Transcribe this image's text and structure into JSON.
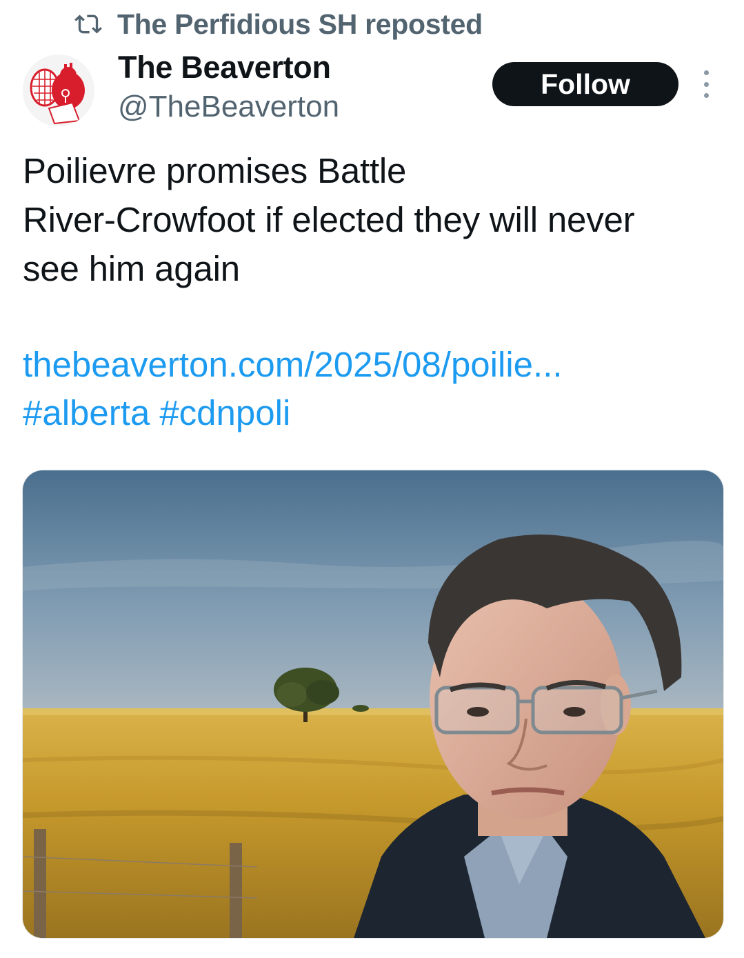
{
  "repost": {
    "label": "The Perfidious SH reposted",
    "icon": "repost-icon"
  },
  "author": {
    "name": "The Beaverton",
    "handle": "@TheBeaverton",
    "avatar_icon": "beaver-logo-icon"
  },
  "follow_label": "Follow",
  "more_icon": "more-options-icon",
  "tweet": {
    "lines": [
      "Poilievre promises Battle",
      "River-Crowfoot if elected they will never",
      "see him again"
    ],
    "link": "thebeaverton.com/2025/08/poilie...",
    "hashtags": [
      "#alberta",
      "#cdnpoli"
    ]
  },
  "colors": {
    "text": "#0f1419",
    "secondary": "#536471",
    "link": "#1d9bf0",
    "button_bg": "#0f1419"
  }
}
